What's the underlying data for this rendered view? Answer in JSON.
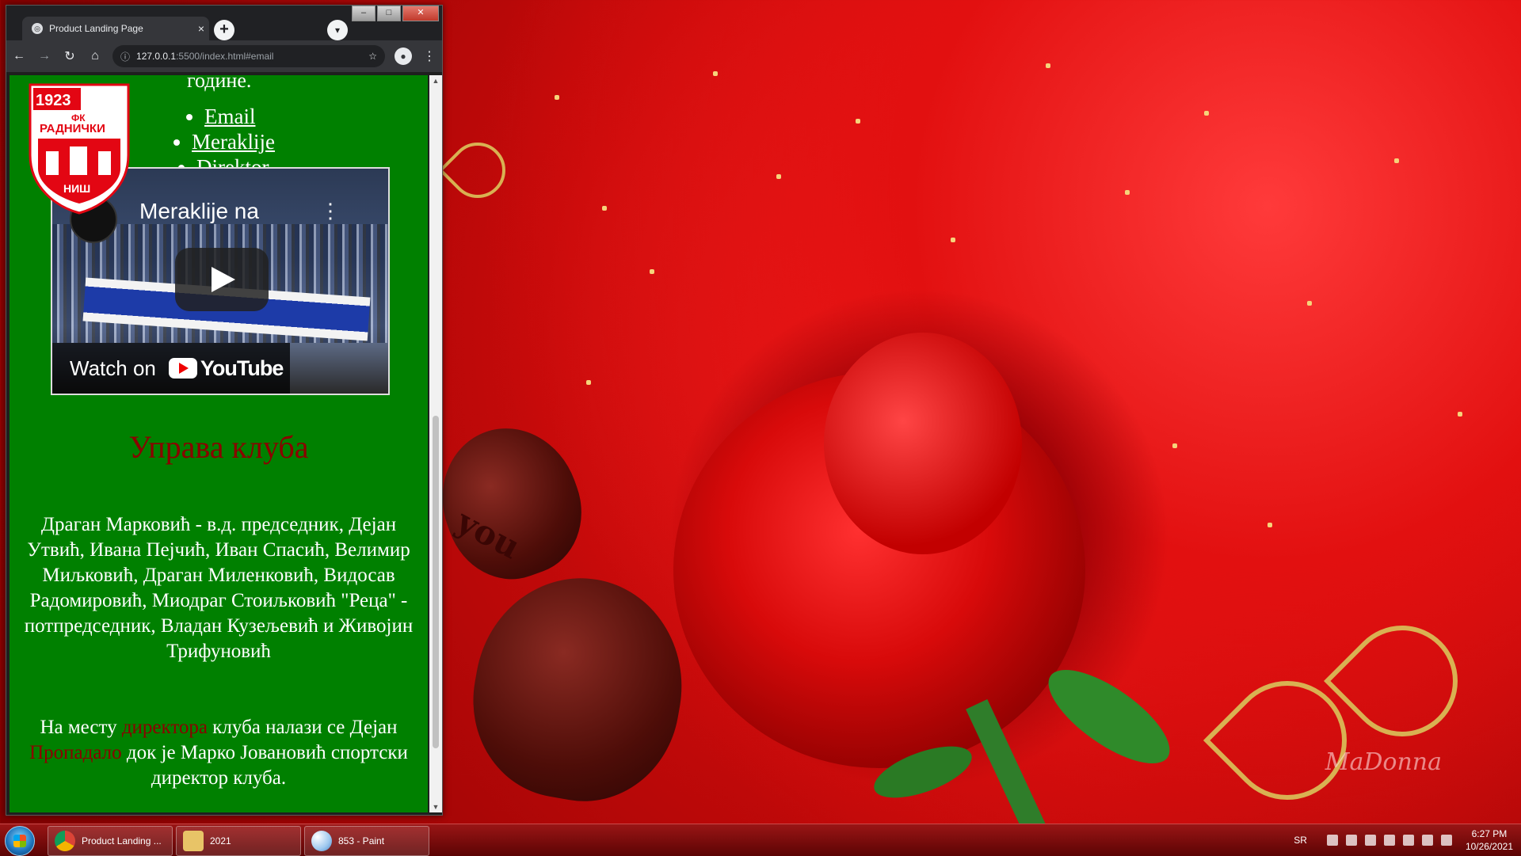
{
  "browser": {
    "tab_title": "Product Landing Page",
    "tab_close": "×",
    "new_tab": "+",
    "url_host": "127.0.0.1",
    "url_path": ":5500/index.html#email",
    "win_min": "–",
    "win_max": "□",
    "win_close": "✕"
  },
  "page": {
    "partial_text": "године.",
    "nav": [
      {
        "label": "Email"
      },
      {
        "label": "Meraklije"
      },
      {
        "label": "Direktor"
      }
    ],
    "logo": {
      "year": "1923",
      "fk": "ФК",
      "name": "РАДНИЧКИ",
      "city": "НИШ",
      "colors": {
        "red": "#e30613",
        "white": "#ffffff"
      }
    },
    "video": {
      "title": "Meraklije na",
      "watch_on": "Watch on",
      "brand": "YouTube",
      "menu": "⋮"
    },
    "management_heading": "Управа клуба",
    "management_text": "Драган Марковић - в.д. председник, Дејан Утвић, Ивана Пејчић, Иван Спасић, Велимир Миљковић, Драган Миленковић, Видосав Радомировић, Миодраг Стоиљковић \"Реца\" - потпредседник, Владан Кузељевић и Живојин Трифуновић",
    "director_text": {
      "part1": "На месту ",
      "highlight1": "директора",
      "part2": " клуба налази се Дејан ",
      "highlight2": "Пропадало",
      "part3": " док је Марко Јовановић спортски директор клуба."
    },
    "colors": {
      "background": "#008000",
      "heading": "#8b0000",
      "text": "#ffffff"
    }
  },
  "desktop": {
    "watermark": "MaDonna",
    "love_text": "you"
  },
  "taskbar": {
    "items": [
      {
        "label": "Product Landing ...",
        "icon": "chrome-icon"
      },
      {
        "label": "2021",
        "icon": "folder-icon"
      },
      {
        "label": "853 - Paint",
        "icon": "paint-icon"
      }
    ],
    "language": "SR",
    "time": "6:27 PM",
    "date": "10/26/2021"
  }
}
